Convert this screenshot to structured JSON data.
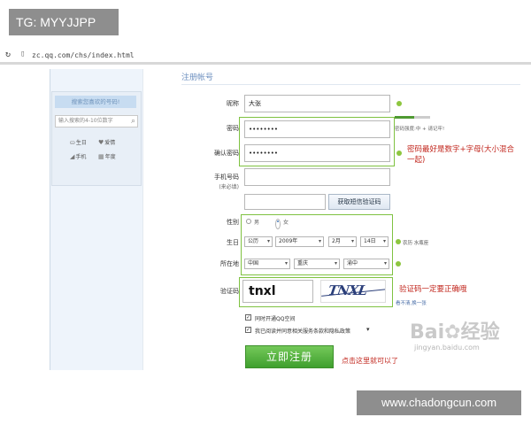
{
  "overlay_tag": "TG: MYYJJPP",
  "browser": {
    "reload_icon": "↻",
    "url": "zc.qq.com/chs/index.html"
  },
  "side_panel": {
    "header": "搜索您喜欢的号码!",
    "search_placeholder": "输入搜索的4-10位数字",
    "items": [
      "生日",
      "爱情",
      "手机",
      "年度"
    ]
  },
  "form": {
    "section_title": "注册帐号",
    "nickname": {
      "label": "昵称",
      "value": "大张"
    },
    "password": {
      "label": "密码",
      "value": "••••••••",
      "hint": "密码强度:中 + 请记牢!"
    },
    "confirm": {
      "label": "确认密码",
      "value": "••••••••"
    },
    "password_note": "密码最好是数字+字母(大小混合一起)",
    "phone": {
      "label": "手机号码",
      "sublabel": "(来必填)",
      "value": ""
    },
    "sms_code": {
      "value": "",
      "button": "获取短信验证码"
    },
    "gender": {
      "label": "性别",
      "options": [
        "男",
        "女"
      ],
      "selected": "女"
    },
    "birthday": {
      "label": "生日",
      "calendar": "公历",
      "year": "2009年",
      "month": "2月",
      "day": "14日",
      "note": "农历 水瓶座"
    },
    "location": {
      "label": "所在地",
      "country": "中国",
      "province": "重庆",
      "city": "渝中"
    },
    "captcha": {
      "label": "验证码",
      "value": "tnxl",
      "image_text": "TNXL",
      "refresh": "看不清,换一张",
      "note": "验证码一定要正确哦"
    },
    "checkbox1": "同时开通QQ空间",
    "checkbox2": "我已阅读并同意相关服务条款和隐私政策",
    "submit": "立即注册",
    "submit_note": "点击这里就可以了"
  },
  "watermark": {
    "brand": "Bai",
    "brand2": "经验",
    "sub": "jingyan.baidu.com"
  },
  "site_tag": "www.chadongcun.com",
  "colors": {
    "accent_green": "#7fc241",
    "note_red": "#c2271e",
    "link_blue": "#6c8fbf"
  }
}
